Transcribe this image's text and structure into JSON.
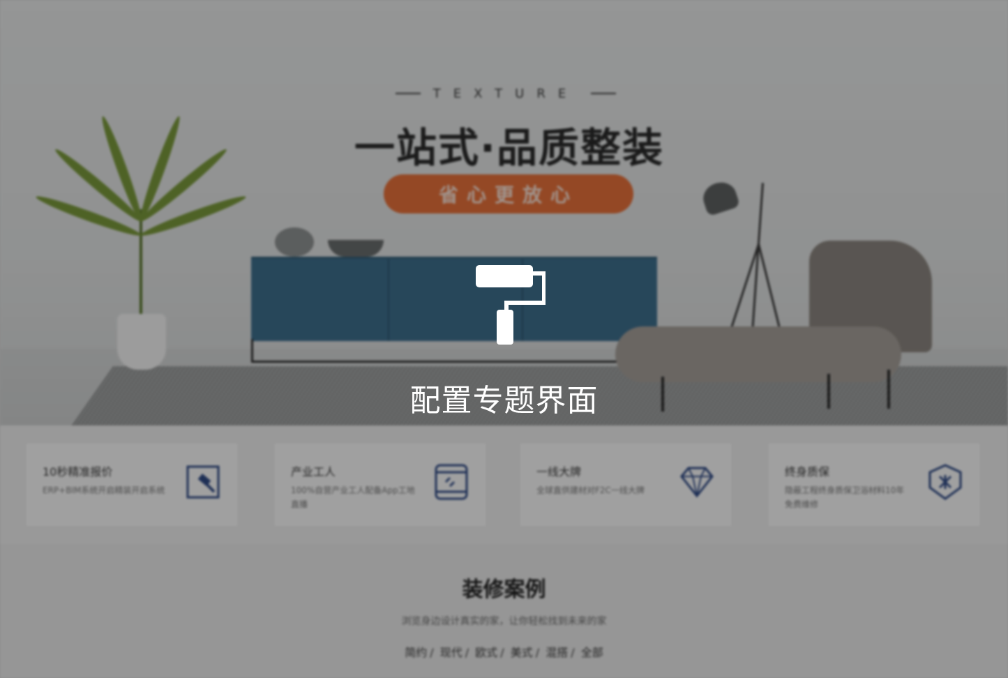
{
  "hero": {
    "tagline": "TEXTURE",
    "headline": "一站式·品质整装",
    "badge": "省心更放心"
  },
  "features": [
    {
      "title": "10秒精准报价",
      "desc": "ERP+BIM系统开启精装开启系统",
      "icon": "hammer-icon"
    },
    {
      "title": "产业工人",
      "desc": "100%自营产业工人配备App工地直播",
      "icon": "phone-icon"
    },
    {
      "title": "一线大牌",
      "desc": "全球直供建材对F2C一线大牌",
      "icon": "diamond-icon"
    },
    {
      "title": "终身质保",
      "desc": "隐蔽工程终身质保卫浴材料10年免费维修",
      "icon": "shield-icon"
    }
  ],
  "cases": {
    "title": "装修案例",
    "subtitle": "浏览身边设计真实的家，让你轻松找到未来的家",
    "categories": [
      "简约",
      "现代",
      "欧式",
      "美式",
      "混搭",
      "全部"
    ],
    "separator": "/"
  },
  "overlay": {
    "icon": "paint-roller-icon",
    "label": "配置专题界面",
    "background": "rgba(0,0,0,0.36)",
    "color": "#ffffff"
  },
  "colors": {
    "accent": "#e8713a",
    "cabinet": "#3e6f8e",
    "icon_blue": "#2f4a86"
  }
}
